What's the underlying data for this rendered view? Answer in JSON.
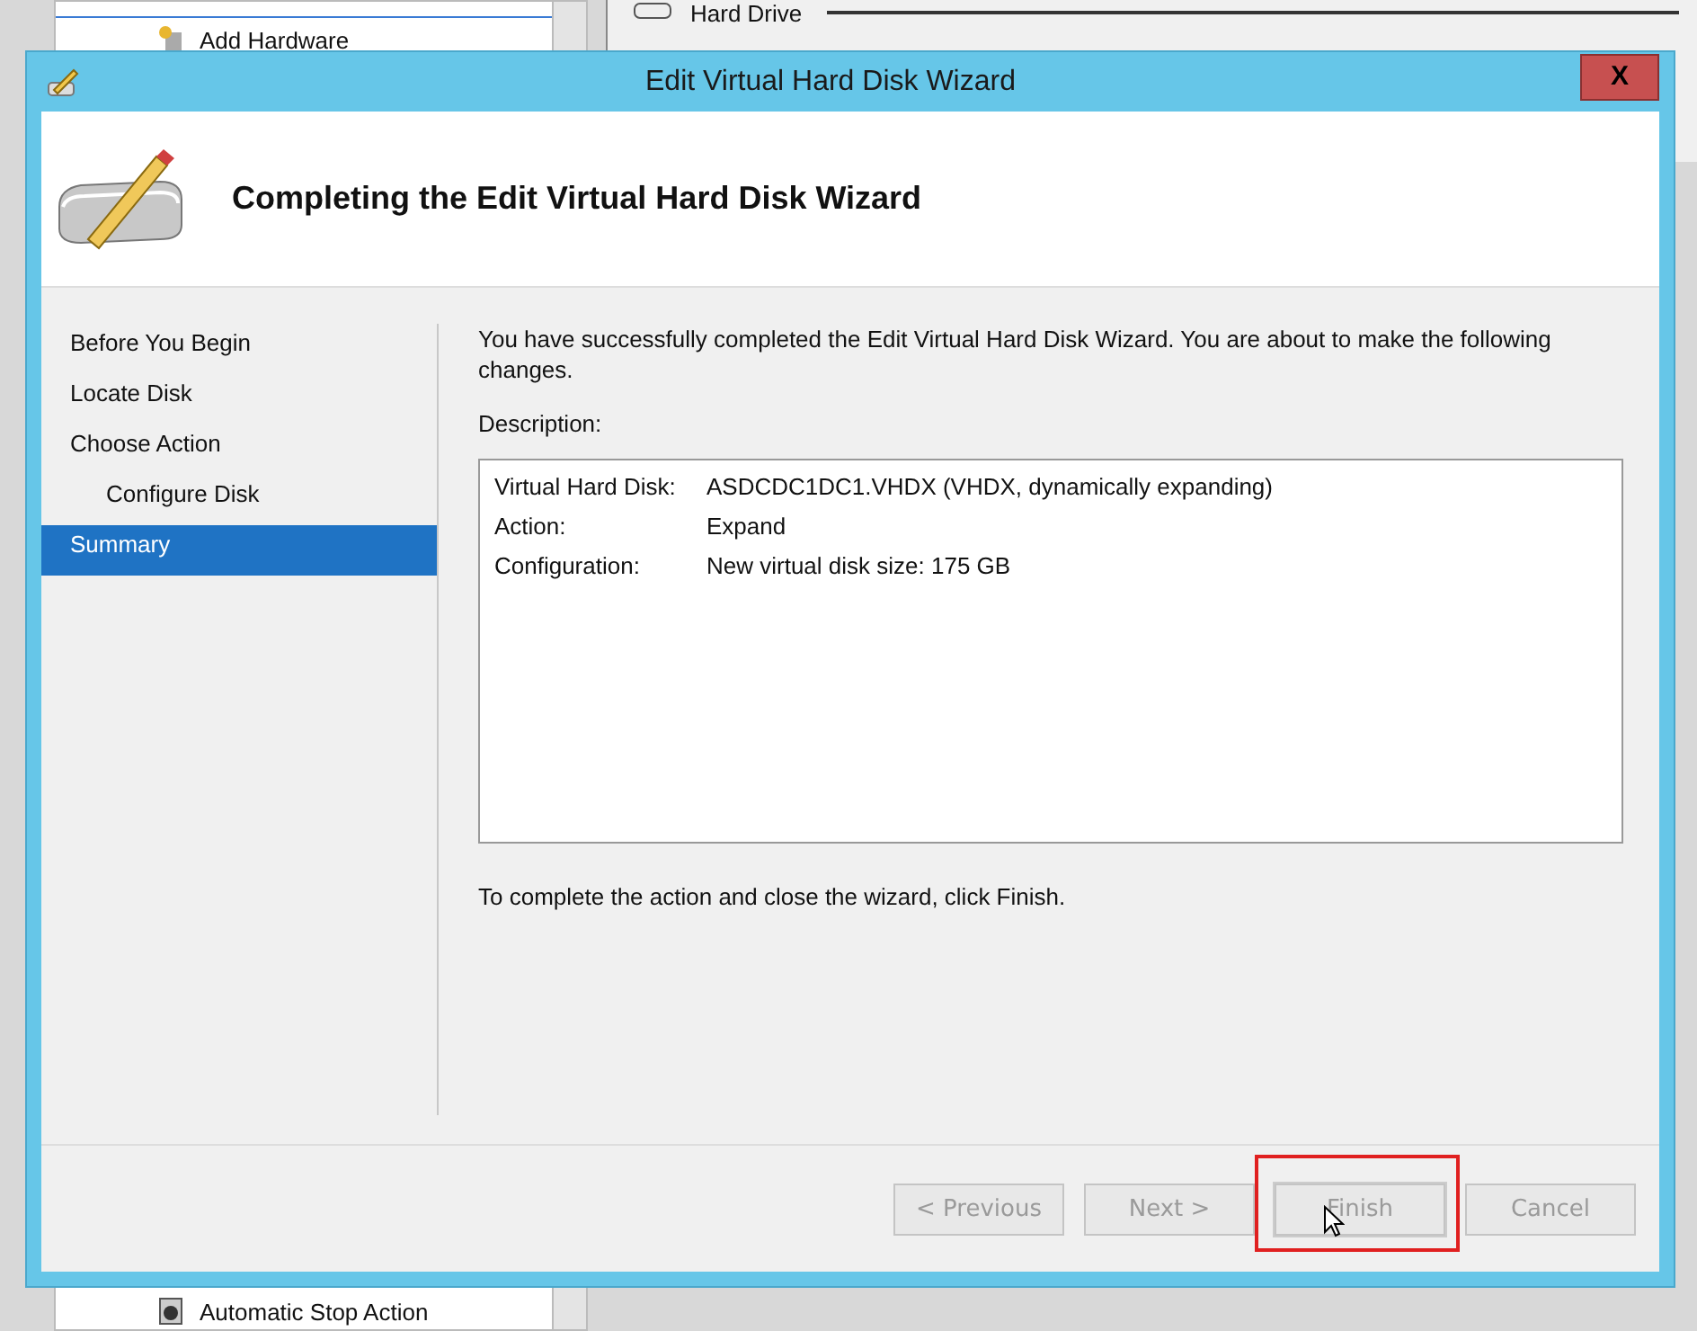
{
  "background": {
    "list_item": "Add Hardware",
    "right_item": "Hard Drive",
    "bottom_item": "Automatic Stop Action"
  },
  "window": {
    "title": "Edit Virtual Hard Disk Wizard",
    "close": "X"
  },
  "header": {
    "title": "Completing the Edit Virtual Hard Disk Wizard"
  },
  "steps": [
    {
      "label": "Before You Begin",
      "selected": false
    },
    {
      "label": "Locate Disk",
      "selected": false
    },
    {
      "label": "Choose Action",
      "selected": false,
      "children": [
        {
          "label": "Configure Disk",
          "selected": false
        }
      ]
    },
    {
      "label": "Summary",
      "selected": true
    }
  ],
  "intro": "You have successfully completed the Edit Virtual Hard Disk Wizard. You are about to make the following changes.",
  "description_label": "Description:",
  "description": [
    {
      "key": "Virtual Hard Disk:",
      "value": "ASDCDC1DC1.VHDX (VHDX, dynamically expanding)"
    },
    {
      "key": "Action:",
      "value": "Expand"
    },
    {
      "key": "Configuration:",
      "value": "New virtual disk size: 175 GB"
    }
  ],
  "footer_note": "To complete the action and close the wizard, click Finish.",
  "buttons": [
    {
      "label": "< Previous",
      "disabled": true,
      "highlighted": false
    },
    {
      "label": "Next >",
      "disabled": true,
      "highlighted": false
    },
    {
      "label": "Finish",
      "disabled": true,
      "highlighted": true
    },
    {
      "label": "Cancel",
      "disabled": true,
      "highlighted": false
    }
  ]
}
